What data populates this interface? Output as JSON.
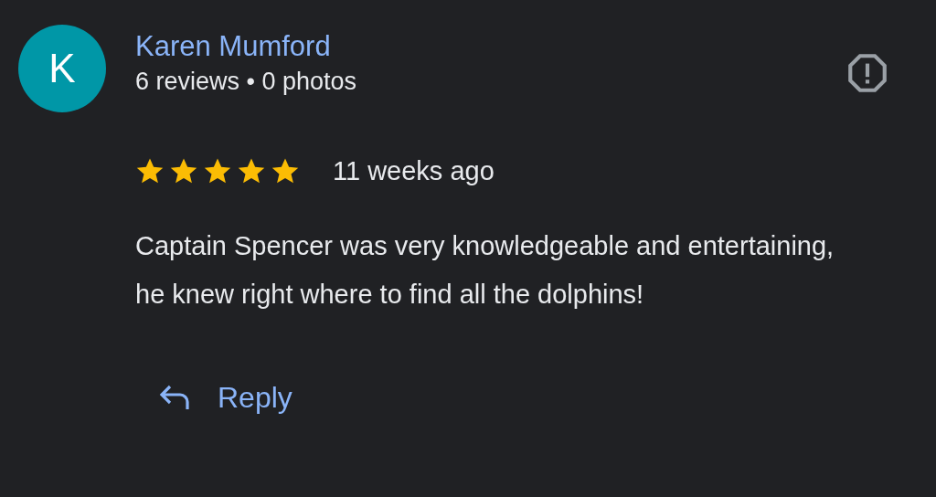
{
  "reviewer": {
    "initial": "K",
    "name": "Karen Mumford",
    "meta": "6 reviews • 0 photos"
  },
  "review": {
    "stars": 5,
    "time": "11 weeks ago",
    "text": "Captain Spencer was very knowledgeable and entertaining, he knew right where to find all the dolphins!"
  },
  "reply_button": {
    "label": "Reply"
  }
}
